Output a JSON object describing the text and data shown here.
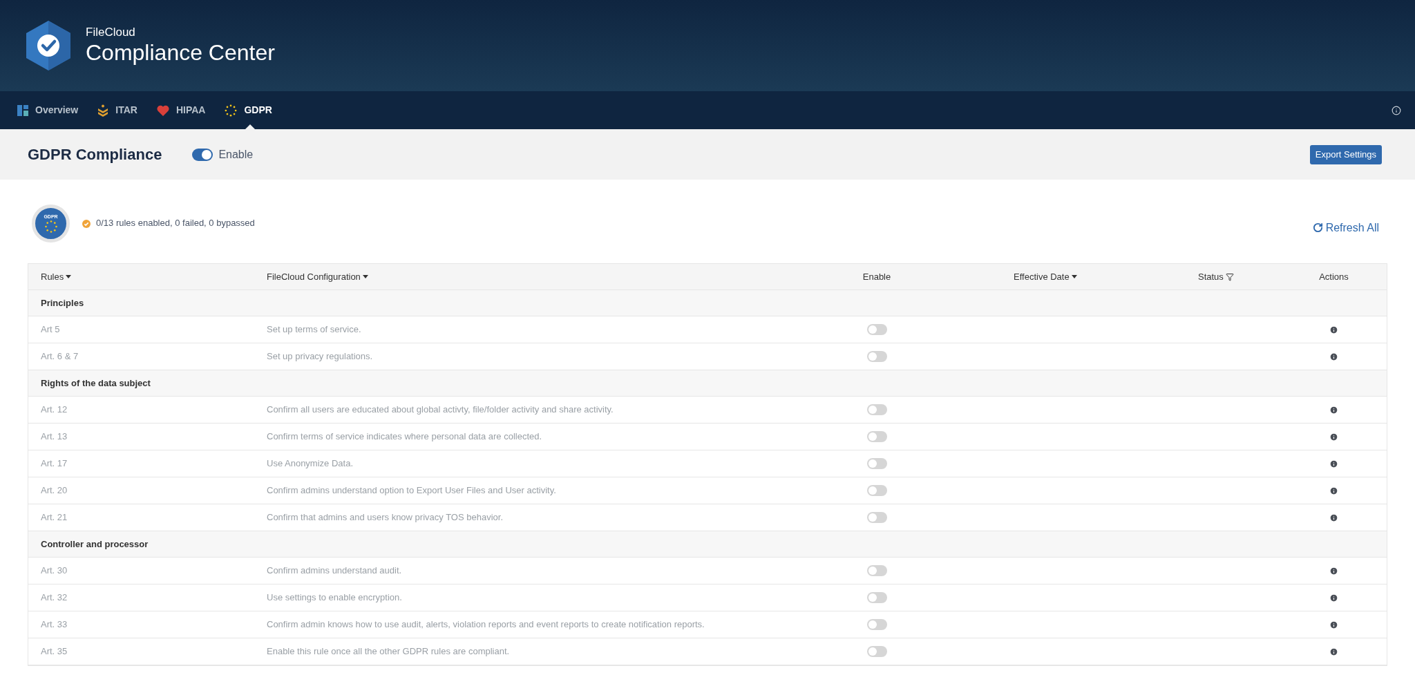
{
  "header": {
    "brand": "FileCloud",
    "title": "Compliance Center"
  },
  "tabs": [
    {
      "label": "Overview",
      "kind": "overview",
      "selected": false
    },
    {
      "label": "ITAR",
      "kind": "itar",
      "selected": false
    },
    {
      "label": "HIPAA",
      "kind": "hipaa",
      "selected": false
    },
    {
      "label": "GDPR",
      "kind": "gdpr",
      "selected": true
    }
  ],
  "page": {
    "title": "GDPR Compliance",
    "enable_label": "Enable",
    "enabled": true,
    "export_button": "Export Settings"
  },
  "summary": {
    "badge_label": "GDPR",
    "text": "0/13 rules enabled, 0 failed, 0 bypassed",
    "refresh": "Refresh All"
  },
  "table": {
    "columns": [
      {
        "label": "Rules",
        "kind": "sort"
      },
      {
        "label": "FileCloud Configuration",
        "kind": "sort"
      },
      {
        "label": "Enable",
        "kind": "plain"
      },
      {
        "label": "Effective Date",
        "kind": "sort"
      },
      {
        "label": "Status",
        "kind": "filter"
      },
      {
        "label": "Actions",
        "kind": "plain"
      }
    ],
    "groups": [
      {
        "name": "Principles",
        "rows": [
          {
            "rule": "Art 5",
            "config": "Set up terms of service.",
            "enabled": false
          },
          {
            "rule": "Art. 6 & 7",
            "config": "Set up privacy regulations.",
            "enabled": false
          }
        ]
      },
      {
        "name": "Rights of the data subject",
        "rows": [
          {
            "rule": "Art. 12",
            "config": "Confirm all users are educated about global activty, file/folder activity and share activity.",
            "enabled": false
          },
          {
            "rule": "Art. 13",
            "config": "Confirm terms of service indicates where personal data are collected.",
            "enabled": false
          },
          {
            "rule": "Art. 17",
            "config": "Use Anonymize Data.",
            "enabled": false
          },
          {
            "rule": "Art. 20",
            "config": "Confirm admins understand option to Export User Files and User activity.",
            "enabled": false
          },
          {
            "rule": "Art. 21",
            "config": "Confirm that admins and users know privacy TOS behavior.",
            "enabled": false
          }
        ]
      },
      {
        "name": "Controller and processor",
        "rows": [
          {
            "rule": "Art. 30",
            "config": "Confirm admins understand audit.",
            "enabled": false
          },
          {
            "rule": "Art. 32",
            "config": "Use settings to enable encryption.",
            "enabled": false
          },
          {
            "rule": "Art. 33",
            "config": "Confirm admin knows how to use audit, alerts, violation reports and event reports to create notification reports.",
            "enabled": false
          },
          {
            "rule": "Art. 35",
            "config": "Enable this rule once all the other GDPR rules are compliant.",
            "enabled": false
          }
        ]
      }
    ]
  }
}
